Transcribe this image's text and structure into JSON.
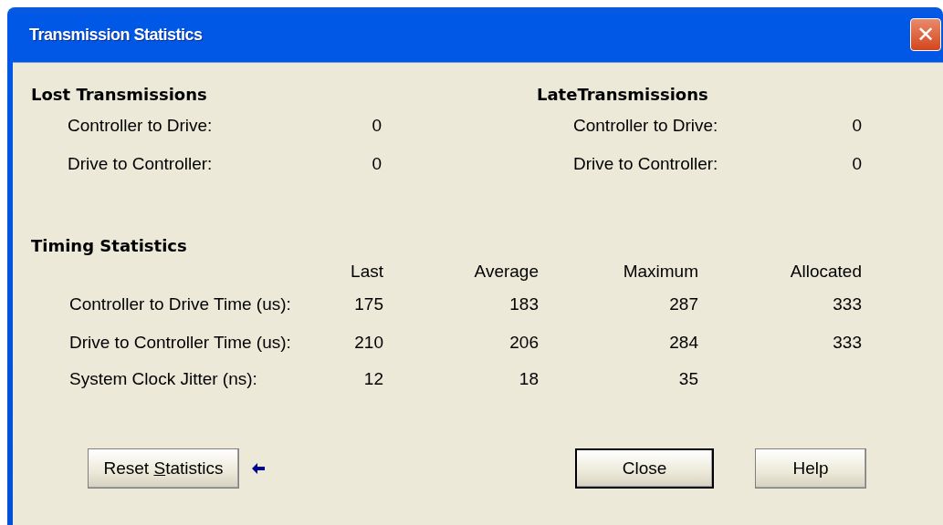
{
  "window": {
    "title": "Transmission Statistics",
    "close_glyph": "✕"
  },
  "lost": {
    "heading": "Lost Transmissions",
    "rows": [
      {
        "label": "Controller to Drive:",
        "value": "0"
      },
      {
        "label": "Drive to Controller:",
        "value": "0"
      }
    ]
  },
  "late": {
    "heading": "LateTransmissions",
    "rows": [
      {
        "label": "Controller to Drive:",
        "value": "0"
      },
      {
        "label": "Drive to Controller:",
        "value": "0"
      }
    ]
  },
  "timing": {
    "heading": "Timing Statistics",
    "columns": [
      "Last",
      "Average",
      "Maximum",
      "Allocated"
    ],
    "rows": [
      {
        "label": "Controller to Drive Time (us):",
        "values": [
          "175",
          "183",
          "287",
          "333"
        ]
      },
      {
        "label": "Drive to Controller Time (us):",
        "values": [
          "210",
          "206",
          "284",
          "333"
        ]
      },
      {
        "label": "System Clock Jitter (ns):",
        "values": [
          "12",
          "18",
          "35"
        ]
      }
    ]
  },
  "buttons": [
    {
      "kind": "reset",
      "label_before": "Reset ",
      "mnemonic": "S",
      "label_after": "tatistics",
      "default": false
    },
    {
      "kind": "close",
      "label_before": "Close",
      "default": true
    },
    {
      "kind": "help",
      "label_before": "Help",
      "default": false
    }
  ]
}
